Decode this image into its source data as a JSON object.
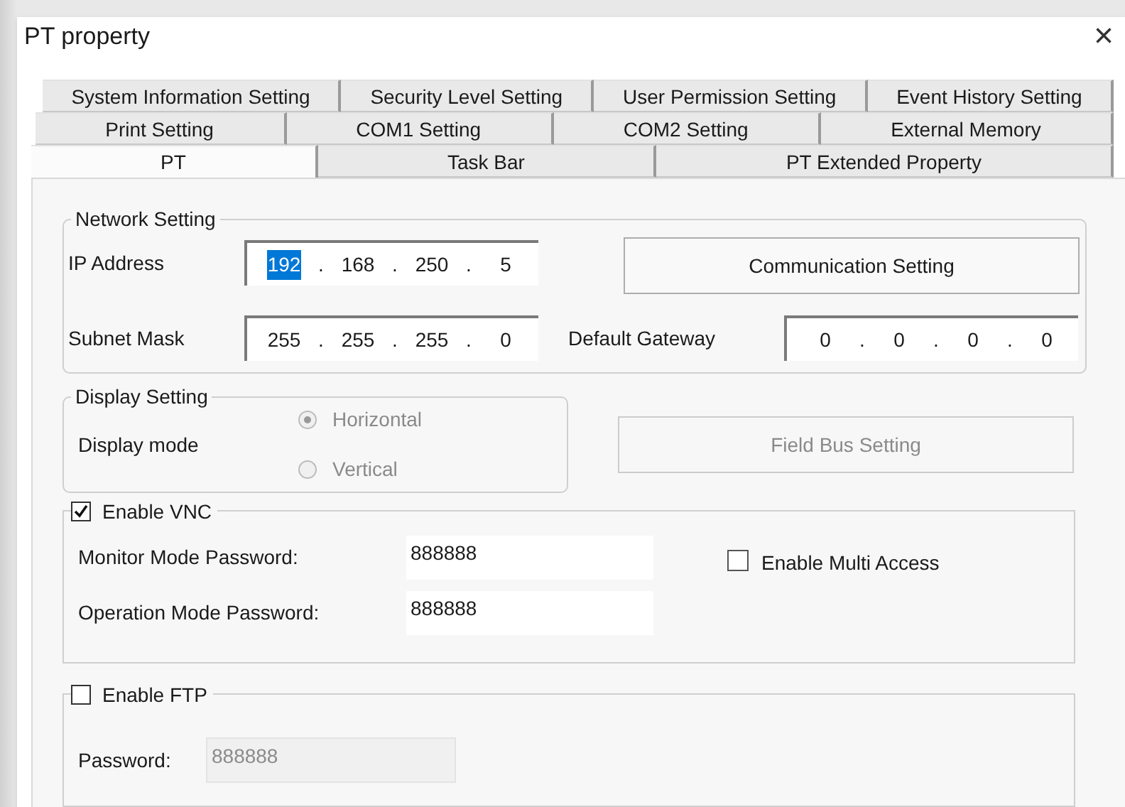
{
  "window": {
    "title": "PT property",
    "close": "×"
  },
  "tab_rows": [
    [
      {
        "label": "System Information Setting",
        "selected": false
      },
      {
        "label": "Security Level Setting",
        "selected": false
      },
      {
        "label": "User Permission Setting",
        "selected": false
      },
      {
        "label": "Event History Setting",
        "selected": false
      }
    ],
    [
      {
        "label": "Print Setting",
        "selected": false
      },
      {
        "label": "COM1 Setting",
        "selected": false
      },
      {
        "label": "COM2 Setting",
        "selected": false
      },
      {
        "label": "External Memory",
        "selected": false
      }
    ],
    [
      {
        "label": "PT",
        "selected": true
      },
      {
        "label": "Task Bar",
        "selected": false
      },
      {
        "label": "PT Extended Property",
        "selected": false
      }
    ]
  ],
  "network_setting": {
    "title": "Network Setting",
    "ip_address": {
      "label": "IP Address",
      "parts": [
        {
          "kind": "octet",
          "text": "192",
          "selected": true
        },
        {
          "kind": "dot",
          "text": ".",
          "selected": false
        },
        {
          "kind": "octet",
          "text": "168",
          "selected": false
        },
        {
          "kind": "dot",
          "text": ".",
          "selected": false
        },
        {
          "kind": "octet",
          "text": "250",
          "selected": false
        },
        {
          "kind": "dot",
          "text": ".",
          "selected": false
        },
        {
          "kind": "octet",
          "text": "5",
          "selected": false
        }
      ]
    },
    "subnet_mask": {
      "label": "Subnet Mask",
      "parts": [
        {
          "kind": "octet",
          "text": "255",
          "selected": false
        },
        {
          "kind": "dot",
          "text": ".",
          "selected": false
        },
        {
          "kind": "octet",
          "text": "255",
          "selected": false
        },
        {
          "kind": "dot",
          "text": ".",
          "selected": false
        },
        {
          "kind": "octet",
          "text": "255",
          "selected": false
        },
        {
          "kind": "dot",
          "text": ".",
          "selected": false
        },
        {
          "kind": "octet",
          "text": "0",
          "selected": false
        }
      ]
    },
    "communication_button": {
      "label": "Communication Setting",
      "disabled": false
    },
    "default_gateway": {
      "label": "Default Gateway",
      "parts": [
        {
          "kind": "octet",
          "text": "0",
          "selected": false
        },
        {
          "kind": "dot",
          "text": ".",
          "selected": false
        },
        {
          "kind": "octet",
          "text": "0",
          "selected": false
        },
        {
          "kind": "dot",
          "text": ".",
          "selected": false
        },
        {
          "kind": "octet",
          "text": "0",
          "selected": false
        },
        {
          "kind": "dot",
          "text": ".",
          "selected": false
        },
        {
          "kind": "octet",
          "text": "0",
          "selected": false
        }
      ]
    }
  },
  "display_setting": {
    "title": "Display Setting",
    "label": "Display mode",
    "disabled": true,
    "options": [
      {
        "label": "Horizontal",
        "selected": true
      },
      {
        "label": "Vertical",
        "selected": false
      }
    ]
  },
  "field_bus_button": {
    "label": "Field Bus Setting",
    "disabled": true
  },
  "vnc": {
    "label": "Enable VNC",
    "checked": true,
    "monitor_password": {
      "label": "Monitor Mode Password:",
      "value": "888888"
    },
    "operation_password": {
      "label": "Operation Mode Password:",
      "value": "888888"
    },
    "multi_access": {
      "label": "Enable Multi Access",
      "checked": false
    }
  },
  "ftp": {
    "label": "Enable FTP",
    "checked": false,
    "password": {
      "label": "Password:",
      "value": "888888",
      "disabled": true
    }
  }
}
